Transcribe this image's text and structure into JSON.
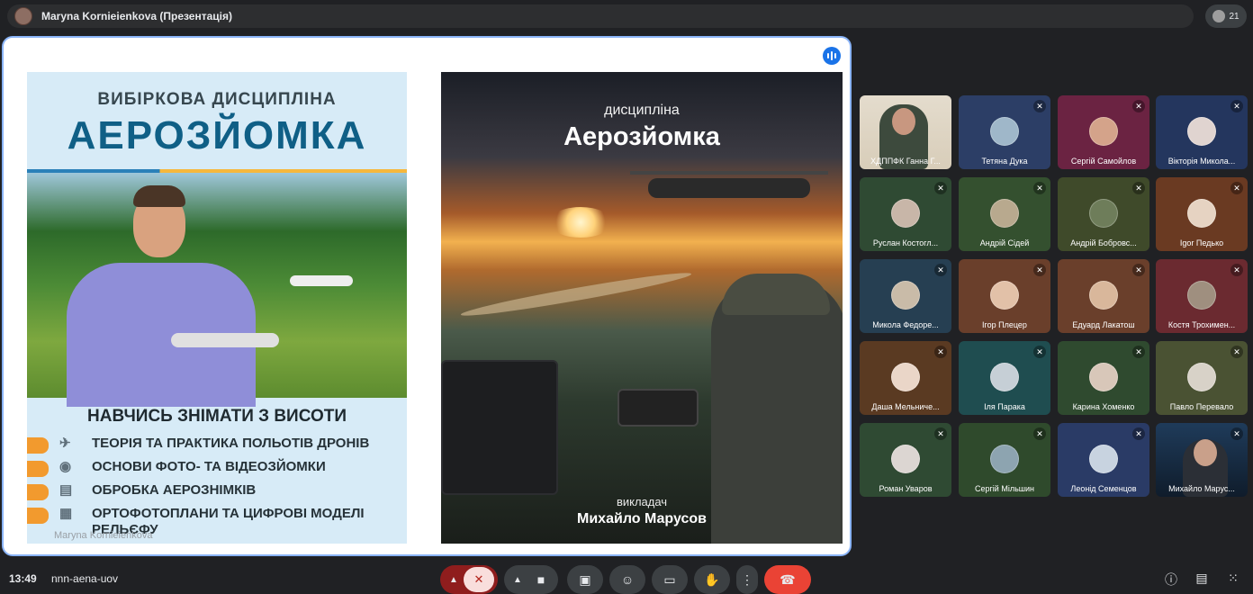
{
  "header": {
    "title": "Maryna Kornieienkova (Презентація)"
  },
  "people_count": "21",
  "stage": {
    "presenter_label": "Maryna Kornieienkova",
    "left_poster": {
      "subtitle": "ВИБІРКОВА ДИСЦИПЛІНА",
      "title": "АЕРОЗЙОМКА",
      "learn": "НАВЧИСЬ ЗНІМАТИ З ВИСОТИ",
      "items": [
        {
          "icon": "drone-icon",
          "glyph": "✈",
          "text": "ТЕОРІЯ ТА ПРАКТИКА ПОЛЬОТІВ ДРОНІВ"
        },
        {
          "icon": "camera-icon",
          "glyph": "◉",
          "text": "ОСНОВИ ФОТО- ТА ВІДЕОЗЙОМКИ"
        },
        {
          "icon": "document-icon",
          "glyph": "▤",
          "text": "ОБРОБКА АЕРОЗНІМКІВ"
        },
        {
          "icon": "map-icon",
          "glyph": "▦",
          "text": "ОРТОФОТОПЛАНИ ТА ЦИФРОВІ МОДЕЛІ РЕЛЬЄФУ"
        }
      ]
    },
    "right_poster": {
      "subtitle": "дисципліна",
      "title": "Аерозйомка",
      "lecturer_label": "викладач",
      "lecturer_name": "Михайло Марусов"
    }
  },
  "participants": [
    {
      "name": "ХДППФК Ганна Г...",
      "bg": "#e4dccd",
      "video": true,
      "mic": "on"
    },
    {
      "name": "Тетяна Дука",
      "bg": "#2c3e66",
      "face": "#9fb7c9",
      "mic": "muted"
    },
    {
      "name": "Сергій Самойлов",
      "bg": "#6b2342",
      "face": "#d4a38a",
      "mic": "muted"
    },
    {
      "name": "Вікторія Микола...",
      "bg": "#24365e",
      "face": "#e0d4d0",
      "mic": "muted"
    },
    {
      "name": "Руслан Костогл...",
      "bg": "#2f4a33",
      "face": "#c8b6a8",
      "mic": "muted"
    },
    {
      "name": "Андрій Сідей",
      "bg": "#34502f",
      "face": "#b8a98e",
      "mic": "muted"
    },
    {
      "name": "Андрій Бобровс...",
      "bg": "#3f4a2a",
      "face": "#6e7d5a",
      "mic": "muted"
    },
    {
      "name": "Igor Педько",
      "bg": "#6a3a22",
      "face": "#e6d3c2",
      "mic": "muted"
    },
    {
      "name": "Микола Федоре...",
      "bg": "#263f52",
      "face": "#c9bba8",
      "mic": "muted"
    },
    {
      "name": "Ігор Плецер",
      "bg": "#6a3f2b",
      "face": "#e2c1a8",
      "mic": "muted"
    },
    {
      "name": "Едуард Лакатош",
      "bg": "#6a3f2b",
      "face": "#d9b79b",
      "mic": "muted"
    },
    {
      "name": "Костя Трохимен...",
      "bg": "#6b2a30",
      "face": "#9f8f7f",
      "mic": "muted"
    },
    {
      "name": "Даша Мельниче...",
      "bg": "#5a3a22",
      "face": "#ead6c8",
      "mic": "muted"
    },
    {
      "name": "Іля Парака",
      "bg": "#1f4d50",
      "face": "#c6cfd6",
      "mic": "muted"
    },
    {
      "name": "Карина Хоменко",
      "bg": "#2f4a2f",
      "face": "#d8c7b9",
      "mic": "muted"
    },
    {
      "name": "Павло Перевало",
      "bg": "#4a5233",
      "face": "#d8d2c8",
      "mic": "muted"
    },
    {
      "name": "Роман Уваров",
      "bg": "#2f4a33",
      "face": "#dcd6d2",
      "mic": "muted"
    },
    {
      "name": "Сергій Мільшин",
      "bg": "#2f4a2c",
      "face": "#8da4b0",
      "mic": "muted"
    },
    {
      "name": "Леонід Семенцов",
      "bg": "#2a3b66",
      "face": "#c8d3e0",
      "mic": "muted"
    },
    {
      "name": "Михайло Марус...",
      "bg": "#1f3b5a",
      "video": true,
      "mic": "muted"
    }
  ],
  "footer": {
    "time": "13:49",
    "meeting_code": "nnn-aena-uov"
  },
  "colors": {
    "accent": "#8ab4f8",
    "end_call": "#ea4335",
    "mic_muted": "#8f1d1d"
  }
}
